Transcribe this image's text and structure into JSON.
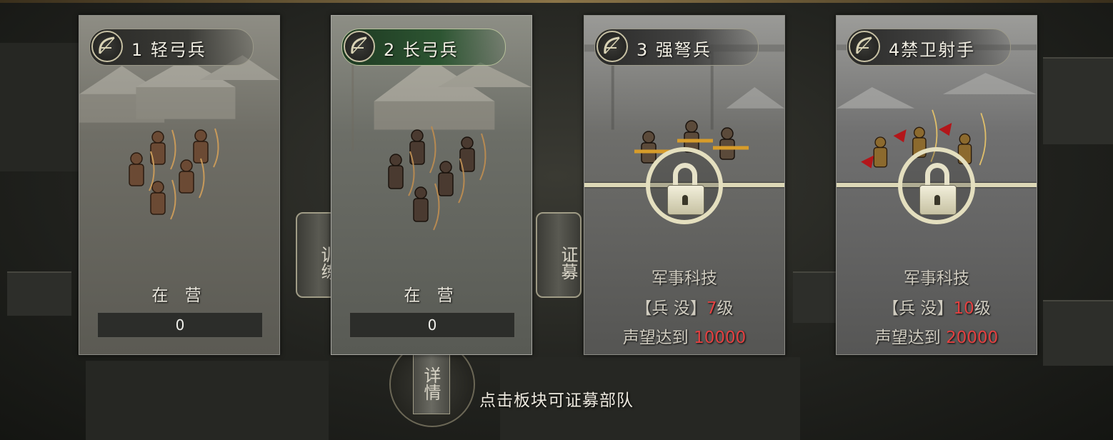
{
  "cards": [
    {
      "title": "1 轻弓兵",
      "status_label": "在 营",
      "count": "0"
    },
    {
      "title": "2 长弓兵",
      "status_label": "在 营",
      "count": "0"
    },
    {
      "title": "3 强弩兵",
      "requirement_title": "军事科技",
      "tech_prefix": "【兵 没】",
      "tech_level": "7",
      "tech_suffix": "级",
      "reputation_prefix": "声望达到 ",
      "reputation_value": "10000"
    },
    {
      "title": "4禁卫射手",
      "requirement_title": "军事科技",
      "tech_prefix": "【兵 没】",
      "tech_level": "10",
      "tech_suffix": "级",
      "reputation_prefix": "声望达到 ",
      "reputation_value": "20000"
    }
  ],
  "side_buttons": {
    "train": "训练",
    "recruit": "证募",
    "details": "详情"
  },
  "hint": "点击板块可证募部队",
  "colors": {
    "requirement_highlight": "#e34141",
    "selected_plate": "#2d5532"
  },
  "icons": {
    "unit_badge": "bow-icon",
    "locked": "padlock-icon"
  }
}
